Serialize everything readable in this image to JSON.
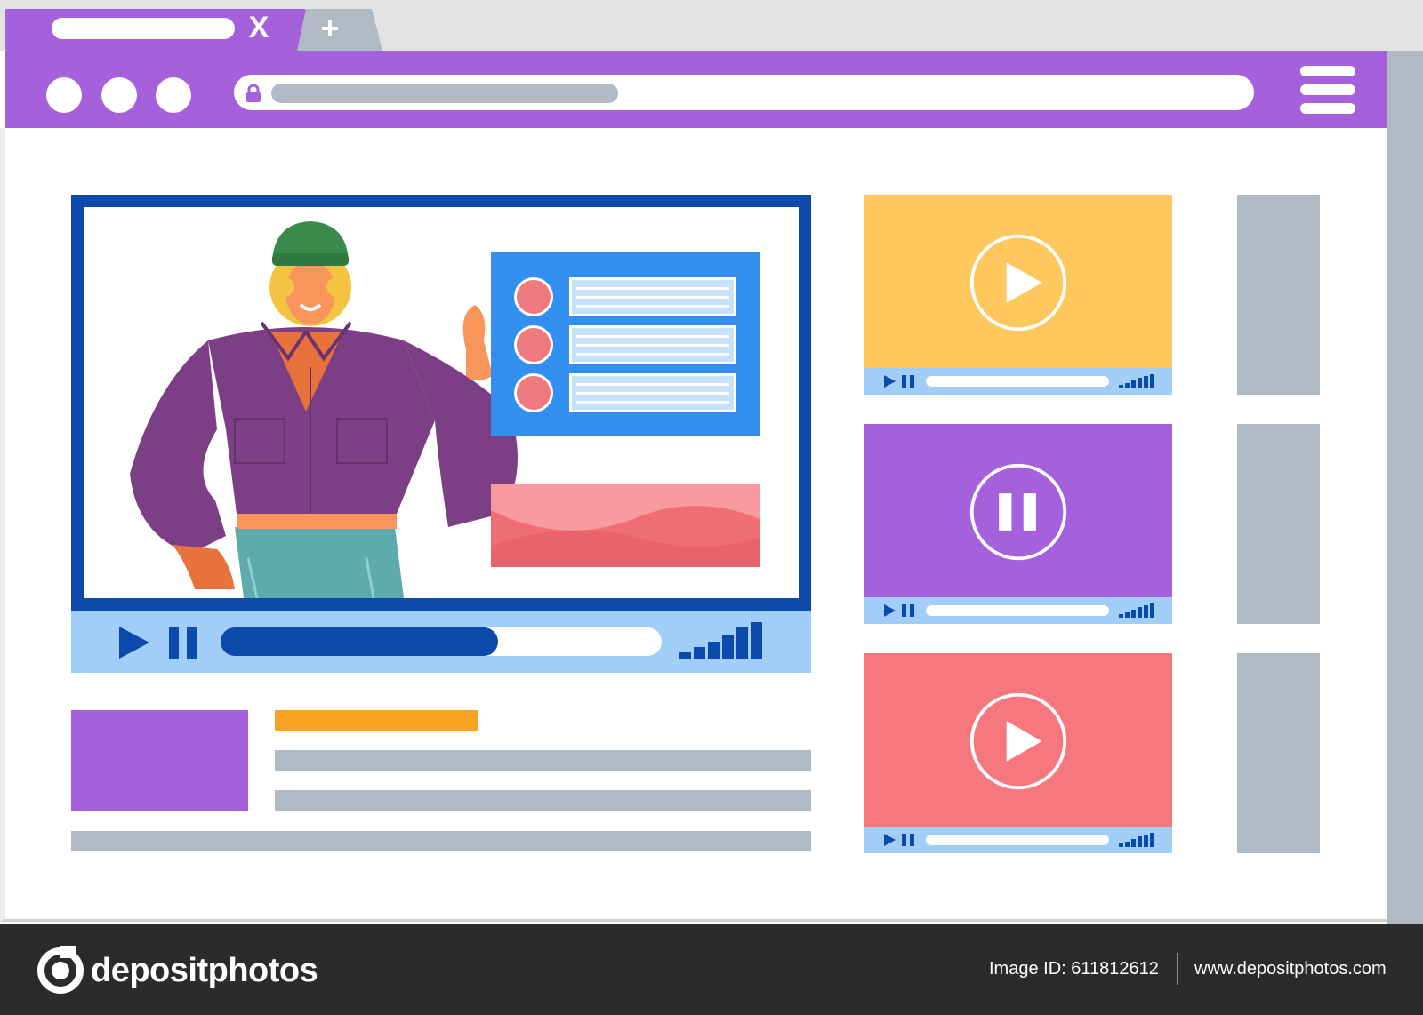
{
  "browser": {
    "tab": {
      "close_glyph": "X",
      "new_tab_glyph": "+"
    },
    "window_controls": [
      "circle",
      "circle",
      "circle"
    ],
    "address_bar": {
      "lock_icon": "lock-icon"
    },
    "menu_icon": "hamburger-menu-icon"
  },
  "main_player": {
    "progress": 0.63,
    "slide": {
      "bullets": 3
    },
    "icons": [
      "play-icon",
      "pause-icon",
      "volume-bars-icon"
    ]
  },
  "playlist": [
    {
      "state": "play",
      "color": "#fec85e"
    },
    {
      "state": "pause",
      "color": "#a560dc"
    },
    {
      "state": "play",
      "color": "#f7777e"
    }
  ],
  "colors": {
    "brand_purple": "#a560dc",
    "player_blue": "#0b4aaa",
    "control_light_blue": "#a1cef8",
    "placeholder_gray": "#b0bac4",
    "accent_orange": "#f7a321"
  },
  "footer": {
    "brand": "depositphotos",
    "image_id": "Image ID: 611812612",
    "site": "www.depositphotos.com"
  }
}
